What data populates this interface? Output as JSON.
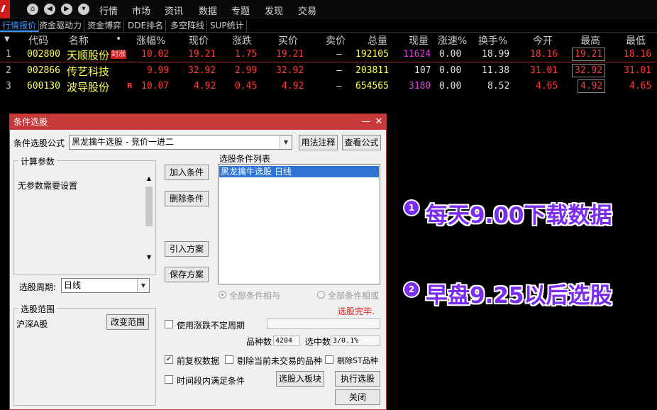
{
  "topbar": {
    "menu": [
      "行情",
      "市场",
      "资讯",
      "数据",
      "专题",
      "发现",
      "交易"
    ]
  },
  "tabs": [
    "行情报价",
    "资金驱动力",
    "资金博弈",
    "DDE排名",
    "多空阵线",
    "SUP统计"
  ],
  "grid": {
    "headers": [
      "代码",
      "名称",
      "•",
      "涨幅%",
      "现价",
      "涨跌",
      "买价",
      "卖价",
      "总量",
      "现量",
      "涨速%",
      "换手%",
      "今开",
      "最高",
      "最低"
    ],
    "rows": [
      {
        "idx": "1",
        "code": "002800",
        "name": "天顺股份",
        "tag": "封涨",
        "pct": "10.02",
        "price": "19.21",
        "chg": "1.75",
        "bid": "19.21",
        "ask": "—",
        "vol": "192105",
        "cur": "11624",
        "speed": "0.00",
        "turn": "18.99",
        "open": "18.16",
        "high": "19.21",
        "low": "18.16"
      },
      {
        "idx": "2",
        "code": "002866",
        "name": "传艺科技",
        "tag": "",
        "pct": "9.99",
        "price": "32.92",
        "chg": "2.99",
        "bid": "32.92",
        "ask": "—",
        "vol": "203811",
        "cur": "107",
        "speed": "0.00",
        "turn": "11.38",
        "open": "31.01",
        "high": "32.92",
        "low": "31.01"
      },
      {
        "idx": "3",
        "code": "600130",
        "name": "波导股份",
        "tag": "R",
        "pct": "10.07",
        "price": "4.92",
        "chg": "0.45",
        "bid": "4.92",
        "ask": "—",
        "vol": "654565",
        "cur": "3180",
        "speed": "0.00",
        "turn": "8.52",
        "open": "4.65",
        "high": "4.92",
        "low": "4.65"
      }
    ]
  },
  "dialog": {
    "title": "条件选股",
    "min": "—",
    "close": "✕",
    "formula_label": "条件选股公式",
    "formula_value": "黑龙擒牛选股 - 竞价一进二",
    "usage_btn": "用法注释",
    "view_btn": "查看公式",
    "params_title": "计算参数",
    "params_text": "无参数需要设置",
    "add_btn": "加入条件",
    "del_btn": "删除条件",
    "import_btn": "引入方案",
    "save_btn": "保存方案",
    "list_title": "选股条件列表",
    "list_item": "黑龙擒牛选股  日线",
    "period_label": "选股周期:",
    "period_value": "日线",
    "radio_and": "全部条件相与",
    "radio_or": "全部条件相或",
    "done_text": "选股完毕.",
    "range_title": "选股范围",
    "range_value": "沪深A股",
    "change_range_btn": "改变范围",
    "uncertain_label": "使用涨跌不定周期",
    "count_label": "品种数",
    "count_value": "4204",
    "selected_label": "选中数",
    "selected_value": "3/0.1%",
    "adj_label": "前复权数据",
    "excl_nontrade_label": "剔除当前未交易的品种",
    "excl_st_label": "剔除ST品种",
    "timerange_label": "时间段内满足条件",
    "to_block_btn": "选股入板块",
    "exec_btn": "执行选股",
    "close_btn": "关闭"
  },
  "annotations": [
    {
      "num": "1",
      "text": "每天9.00下载数据"
    },
    {
      "num": "2",
      "text": "早盘9.25以后选股"
    }
  ],
  "colors": {
    "up": "#ff3b3b",
    "accent": "#7a2cf0",
    "title_bar": "#c83a3a"
  }
}
